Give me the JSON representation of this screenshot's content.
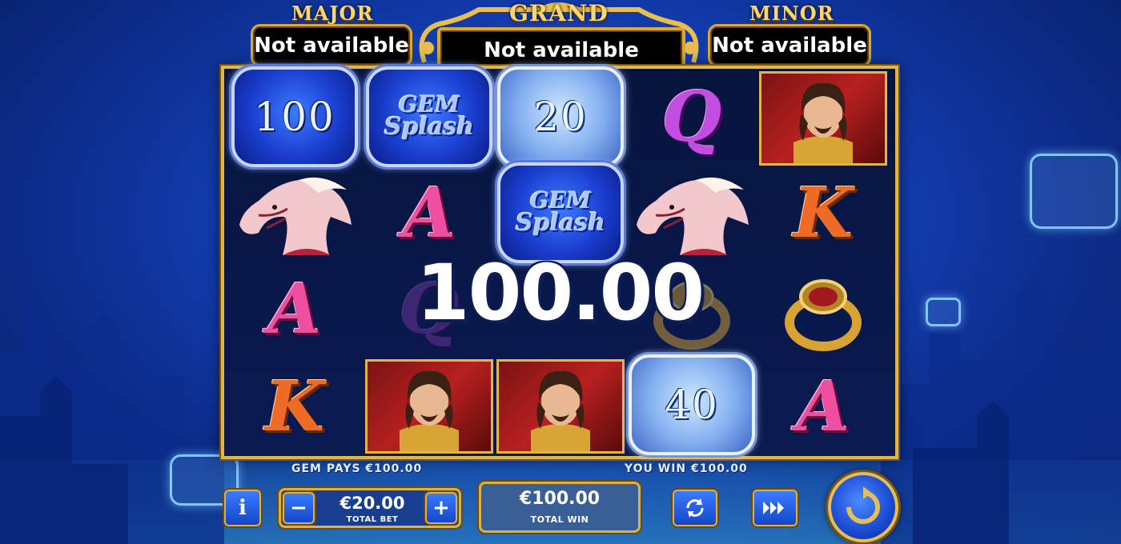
{
  "jackpots": {
    "major": {
      "title": "MAJOR",
      "value": "Not available"
    },
    "grand": {
      "title": "GRAND",
      "value": "Not available"
    },
    "minor": {
      "title": "MINOR",
      "value": "Not available"
    }
  },
  "reels": {
    "cells": [
      {
        "col": 0,
        "row": 0,
        "symbol": "gem-blue",
        "text": "100"
      },
      {
        "col": 1,
        "row": 0,
        "symbol": "gem-splash",
        "line1": "GEM",
        "line2": "Splash"
      },
      {
        "col": 2,
        "row": 0,
        "symbol": "gem-clear",
        "text": "20"
      },
      {
        "col": 3,
        "row": 0,
        "symbol": "letter-q",
        "text": "Q"
      },
      {
        "col": 4,
        "row": 0,
        "symbol": "hero"
      },
      {
        "col": 0,
        "row": 1,
        "symbol": "horse"
      },
      {
        "col": 1,
        "row": 1,
        "symbol": "letter-a",
        "text": "A"
      },
      {
        "col": 2,
        "row": 1,
        "symbol": "gem-splash",
        "line1": "GEM",
        "line2": "Splash"
      },
      {
        "col": 3,
        "row": 1,
        "symbol": "horse"
      },
      {
        "col": 4,
        "row": 1,
        "symbol": "letter-k",
        "text": "K"
      },
      {
        "col": 0,
        "row": 2,
        "symbol": "letter-a",
        "text": "A"
      },
      {
        "col": 1,
        "row": 2,
        "symbol": "letter-q",
        "text": "Q"
      },
      {
        "col": 3,
        "row": 2,
        "symbol": "ring"
      },
      {
        "col": 4,
        "row": 2,
        "symbol": "ring"
      },
      {
        "col": 0,
        "row": 3,
        "symbol": "letter-k",
        "text": "K"
      },
      {
        "col": 1,
        "row": 3,
        "symbol": "hero"
      },
      {
        "col": 2,
        "row": 3,
        "symbol": "hero"
      },
      {
        "col": 3,
        "row": 3,
        "symbol": "gem-clear",
        "text": "40"
      },
      {
        "col": 4,
        "row": 3,
        "symbol": "letter-a",
        "text": "A"
      }
    ]
  },
  "big_win": "100.00",
  "gem_pays": "GEM PAYS €100.00",
  "you_win": "YOU WIN €100.00",
  "controls": {
    "info_label": "i",
    "minus_label": "−",
    "plus_label": "+",
    "total_bet_value": "€20.00",
    "total_bet_caption": "TOTAL BET",
    "total_win_value": "€100.00",
    "total_win_caption": "TOTAL WIN"
  },
  "colors": {
    "gold": "#e0b54a",
    "button_blue": "#1f5ae0",
    "background_blue": "#1440b8"
  }
}
